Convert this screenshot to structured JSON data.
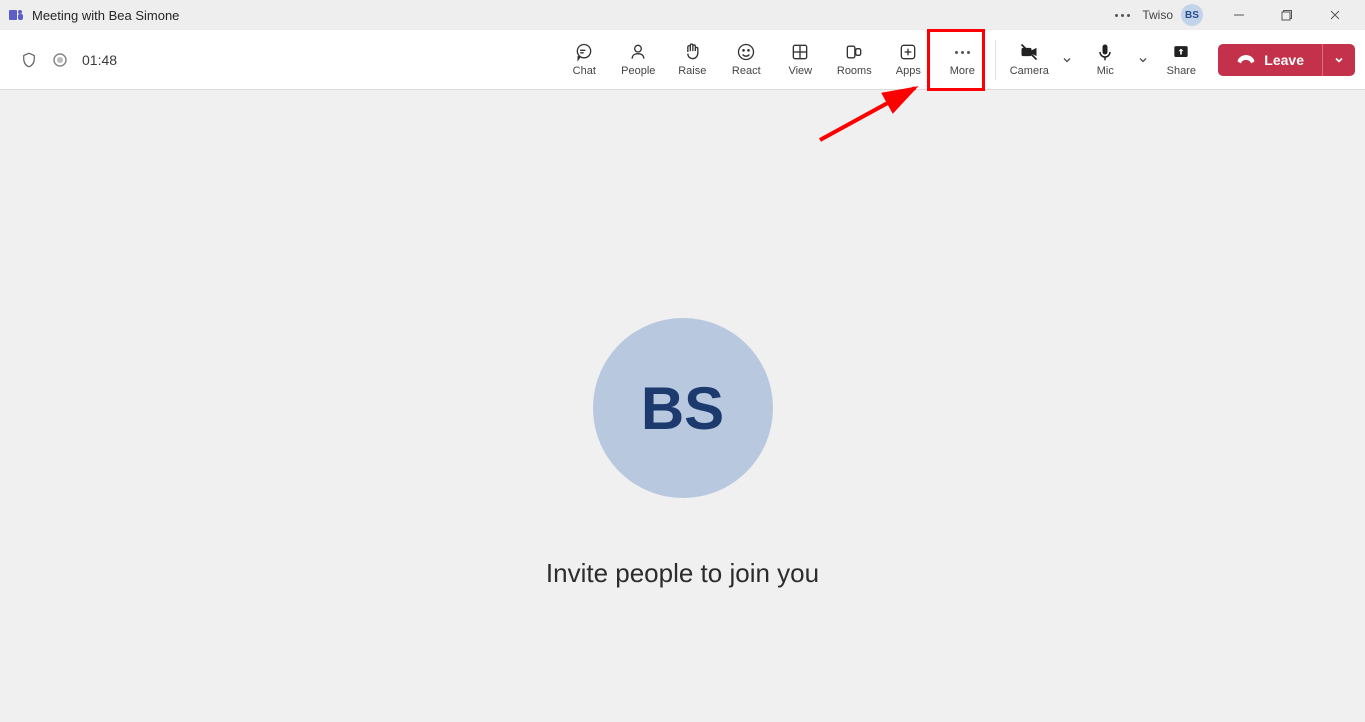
{
  "titlebar": {
    "title": "Meeting with Bea Simone",
    "account": "Twiso",
    "avatar_initials": "BS"
  },
  "toolbar": {
    "timer": "01:48",
    "buttons": {
      "chat": "Chat",
      "people": "People",
      "raise": "Raise",
      "react": "React",
      "view": "View",
      "rooms": "Rooms",
      "apps": "Apps",
      "more": "More",
      "camera": "Camera",
      "mic": "Mic",
      "share": "Share"
    },
    "leave_label": "Leave"
  },
  "main": {
    "avatar_initials": "BS",
    "invite_text": "Invite people to join you"
  },
  "annotation": {
    "highlight_target": "more-button"
  }
}
